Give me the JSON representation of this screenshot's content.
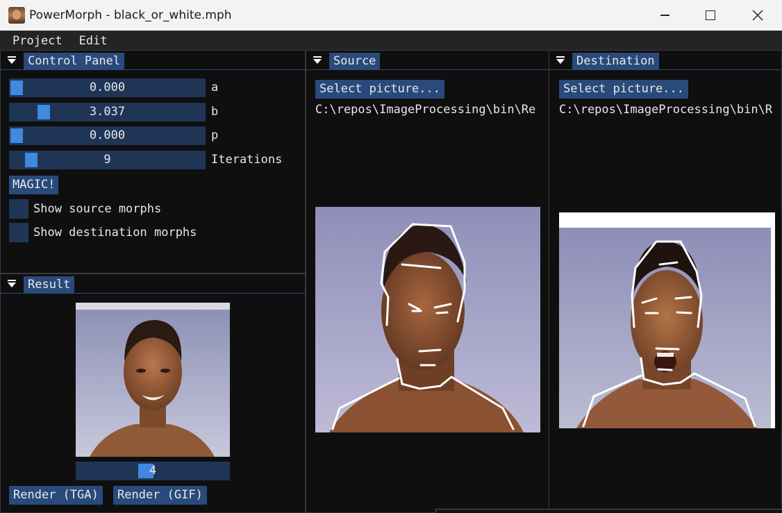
{
  "window": {
    "title": "PowerMorph - black_or_white.mph",
    "icons": [
      "app-icon",
      "minimize-icon",
      "maximize-icon",
      "close-icon"
    ]
  },
  "menu": {
    "items": [
      {
        "label": "Project"
      },
      {
        "label": "Edit"
      }
    ]
  },
  "control_panel": {
    "title": "Control Panel",
    "sliders": [
      {
        "value": "0.000",
        "label": "a",
        "fraction": 0.0
      },
      {
        "value": "3.037",
        "label": "b",
        "fraction": 0.15
      },
      {
        "value": "0.000",
        "label": "p",
        "fraction": 0.0
      },
      {
        "value": "9",
        "label": "Iterations",
        "fraction": 0.08
      }
    ],
    "magic_button": "MAGIC!",
    "checkboxes": [
      {
        "label": "Show source morphs",
        "checked": false
      },
      {
        "label": "Show destination morphs",
        "checked": false
      }
    ]
  },
  "result": {
    "title": "Result",
    "frame_slider": {
      "value": "4",
      "fraction": 0.45
    },
    "render_tga": "Render (TGA)",
    "render_gif": "Render (GIF)"
  },
  "source": {
    "title": "Source",
    "select_button": "Select picture...",
    "path": "C:\\repos\\ImageProcessing\\bin\\Re"
  },
  "destination": {
    "title": "Destination",
    "select_button": "Select picture...",
    "path": "C:\\repos\\ImageProcessing\\bin\\R"
  },
  "colors": {
    "accent": "#4287e0",
    "frame_bg": "#1f3556",
    "button_bg": "#294a7a",
    "window_bg": "#0f0f0f"
  }
}
